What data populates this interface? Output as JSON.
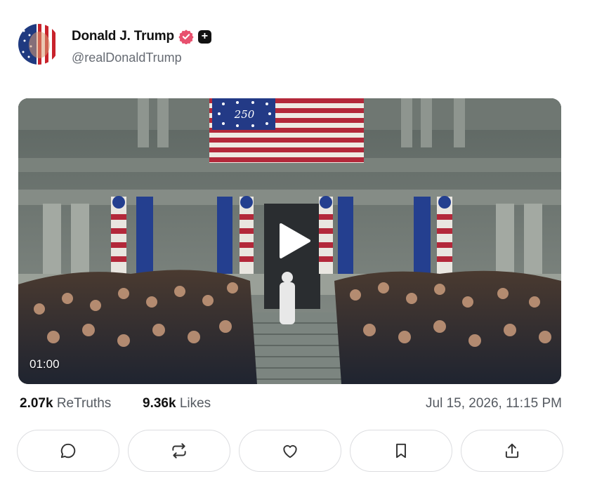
{
  "post": {
    "author_name": "Donald J. Trump",
    "handle": "@realDonaldTrump",
    "plus_badge": "+",
    "verified_color": "#e8506e",
    "video": {
      "duration": "01:00",
      "flag_text": "250"
    },
    "stats": {
      "retruths_count": "2.07k",
      "retruths_label": "ReTruths",
      "likes_count": "9.36k",
      "likes_label": "Likes"
    },
    "timestamp": "Jul 15, 2026, 11:15 PM"
  },
  "actions": [
    {
      "name": "reply",
      "icon": "comment-icon"
    },
    {
      "name": "retruth",
      "icon": "repost-icon"
    },
    {
      "name": "like",
      "icon": "heart-icon"
    },
    {
      "name": "bookmark",
      "icon": "bookmark-icon"
    },
    {
      "name": "share",
      "icon": "share-icon"
    }
  ]
}
